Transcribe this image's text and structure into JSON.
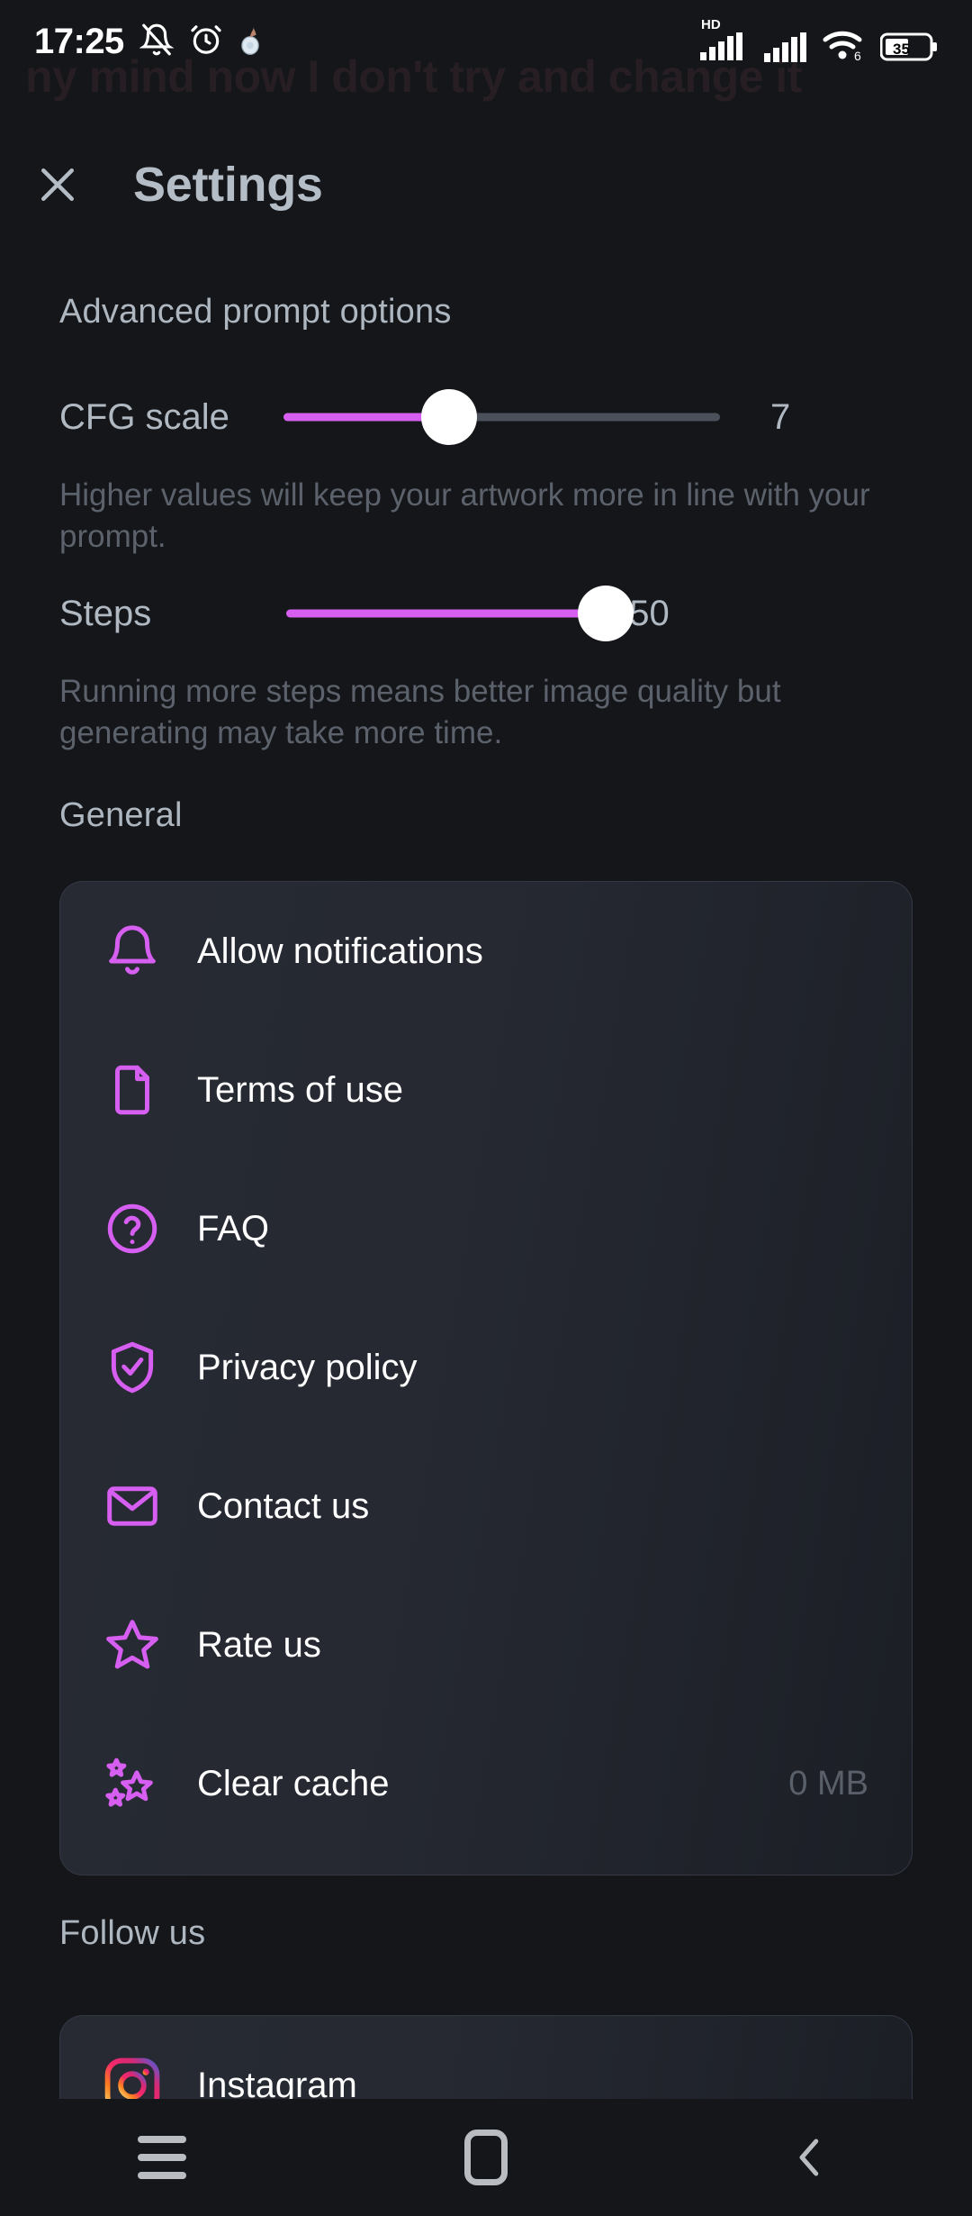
{
  "statusbar": {
    "time": "17:25",
    "left_icons": [
      "bell-muted-icon",
      "alarm-clock-icon",
      "app-small-icon"
    ],
    "right_icons": [
      "hd-label",
      "signal-1-icon",
      "signal-2-icon",
      "wifi-6-icon",
      "battery-icon"
    ],
    "hd_label": "HD",
    "wifi_label": "6",
    "battery_level": "35"
  },
  "background": {
    "ghost_prompt_text": "ny mind now I don't try and change it"
  },
  "header": {
    "title": "Settings",
    "close_label": "✕"
  },
  "sections": {
    "advanced": "Advanced prompt options",
    "general": "General",
    "follow": "Follow us"
  },
  "sliders": [
    {
      "key": "cfg",
      "label": "CFG scale",
      "value": "7",
      "fill_percent": 38,
      "helper": "Higher values will keep your artwork more in line with your prompt."
    },
    {
      "key": "steps",
      "label": "Steps",
      "value": "50",
      "fill_percent": 100,
      "helper": "Running more steps means better image quality but generating may take more time."
    }
  ],
  "general_items": [
    {
      "label": "Allow notifications",
      "icon": "bell-icon",
      "value": ""
    },
    {
      "label": "Terms of use",
      "icon": "document-icon",
      "value": ""
    },
    {
      "label": "FAQ",
      "icon": "question-circle-icon",
      "value": ""
    },
    {
      "label": "Privacy policy",
      "icon": "shield-check-icon",
      "value": ""
    },
    {
      "label": "Contact us",
      "icon": "envelope-icon",
      "value": ""
    },
    {
      "label": "Rate us",
      "icon": "star-icon",
      "value": ""
    },
    {
      "label": "Clear cache",
      "icon": "sparkle-stars-icon",
      "value": "0 MB"
    }
  ],
  "follow_items": [
    {
      "label": "Instagram",
      "icon": "instagram-icon",
      "value": ""
    }
  ],
  "navbar": {
    "recents_label": "recents-icon",
    "home_label": "home-icon",
    "back_label": "back-icon"
  },
  "colors": {
    "accent": "#d65ef0",
    "background": "#141619",
    "card": "#262932",
    "label": "#b0b8c2",
    "helper": "#5c626c"
  }
}
